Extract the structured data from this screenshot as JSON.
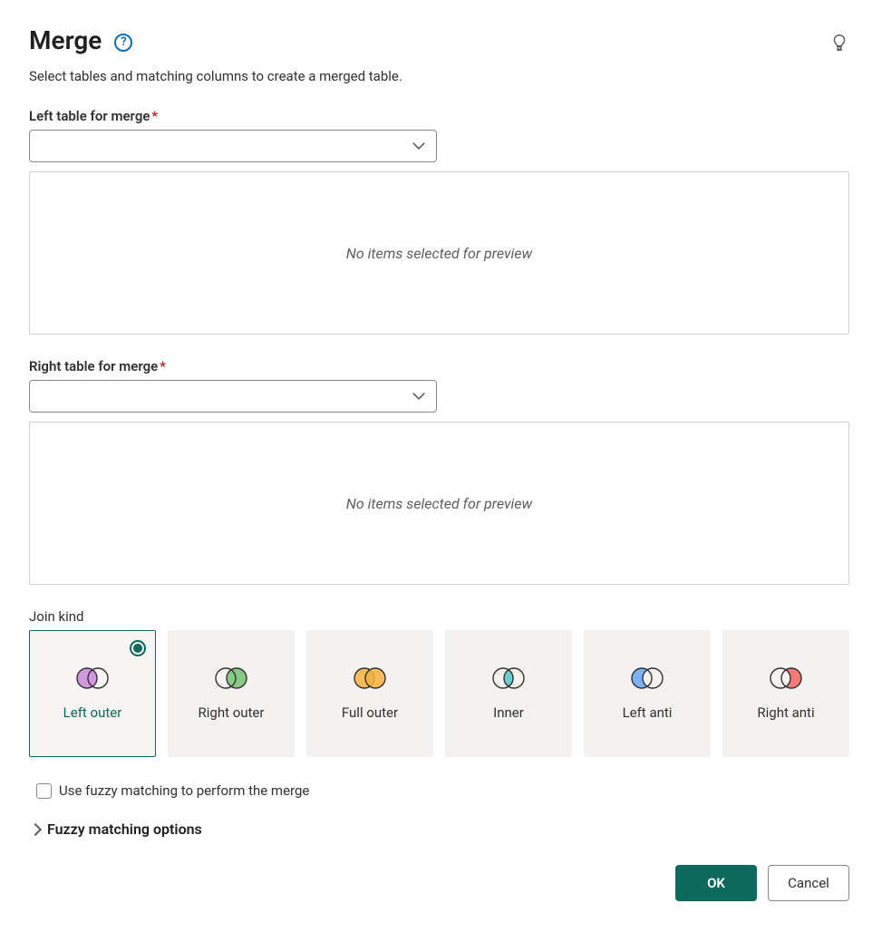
{
  "header": {
    "title": "Merge",
    "subtitle": "Select tables and matching columns to create a merged table."
  },
  "left_table": {
    "label": "Left table for merge",
    "required_mark": "*",
    "value": "",
    "preview_empty": "No items selected for preview"
  },
  "right_table": {
    "label": "Right table for merge",
    "required_mark": "*",
    "value": "",
    "preview_empty": "No items selected for preview"
  },
  "join": {
    "label": "Join kind",
    "selected": "left_outer",
    "options": {
      "left_outer": "Left outer",
      "right_outer": "Right outer",
      "full_outer": "Full outer",
      "inner": "Inner",
      "left_anti": "Left anti",
      "right_anti": "Right anti"
    }
  },
  "fuzzy": {
    "checkbox_label": "Use fuzzy matching to perform the merge",
    "checked": false,
    "options_label": "Fuzzy matching options"
  },
  "footer": {
    "ok": "OK",
    "cancel": "Cancel"
  },
  "colors": {
    "accent": "#0b6a5b",
    "link": "#0f6cbd",
    "left_outer_left": "#c239b3",
    "right_outer_right": "#13a10e",
    "full_outer": "#f7a300",
    "inner_overlap": "#00b7c3",
    "left_anti_left": "#4f8ef7",
    "right_anti_right": "#e74856"
  }
}
